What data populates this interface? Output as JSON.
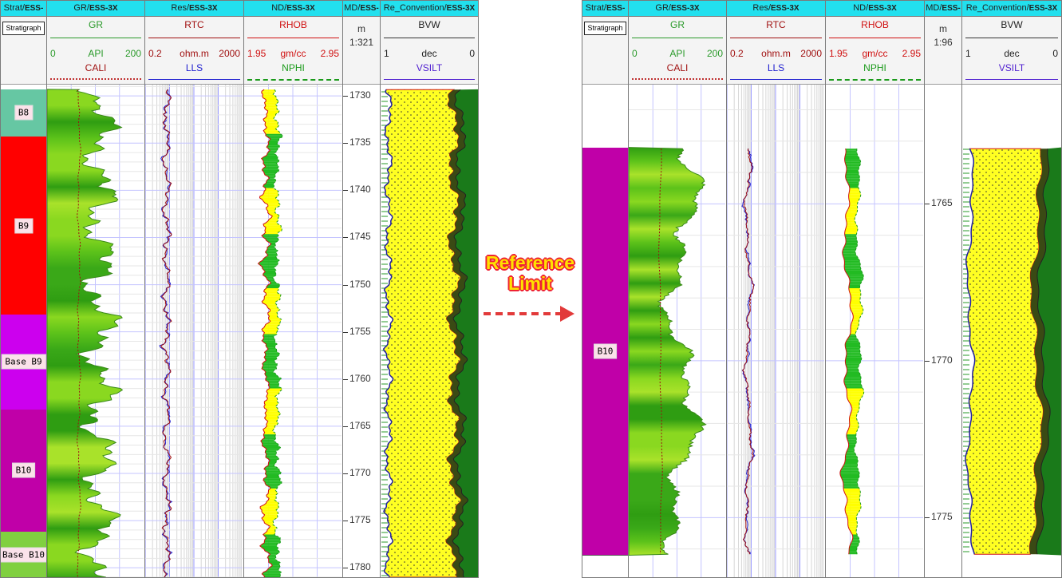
{
  "panels": [
    {
      "id": "left",
      "columns": {
        "strat": {
          "title": "Strat/",
          "suffix": "ESS-",
          "button": "Stratigraph"
        },
        "gr": {
          "title": "GR/",
          "suffix": "ESS-3X",
          "curve1": {
            "name": "GR",
            "lo": "0",
            "unit": "API",
            "hi": "200",
            "color": "#2a9a2a"
          },
          "curve2": {
            "name": "CALI",
            "color": "#a01010"
          }
        },
        "res": {
          "title": "Res/",
          "suffix": "ESS-3X",
          "curve1": {
            "name": "RTC",
            "lo": "0.2",
            "unit": "ohm.m",
            "hi": "2000",
            "color": "#a01010"
          },
          "curve2": {
            "name": "LLS",
            "color": "#2020d0"
          }
        },
        "nd": {
          "title": "ND/",
          "suffix": "ESS-3X",
          "curve1": {
            "name": "RHOB",
            "lo": "1.95",
            "unit": "gm/cc",
            "hi": "2.95",
            "color": "#d01010"
          },
          "curve2": {
            "name": "NPHI",
            "color": "#1a9a1a"
          }
        },
        "md": {
          "title": "MD/",
          "suffix": "ESS-",
          "unit": "m",
          "scale": "1:321"
        },
        "re": {
          "title": "Re_Convention/",
          "suffix": "ESS-3X",
          "curve1": {
            "name": "BVW",
            "lo": "1",
            "unit": "dec",
            "hi": "0",
            "color": "#222222"
          },
          "curve2": {
            "name": "VSILT",
            "color": "#5020d0"
          }
        }
      },
      "zones": [
        {
          "name": "B8",
          "top": 1729.3,
          "base": 1734.3,
          "color": "#66c7a3"
        },
        {
          "name": "B9",
          "top": 1734.3,
          "base": 1753.2,
          "color": "#ff0000"
        },
        {
          "name": "Base B9",
          "top": 1753.2,
          "base": 1763.2,
          "color": "#cc00ee"
        },
        {
          "name": "B10",
          "top": 1763.2,
          "base": 1776.2,
          "color": "#c000a8"
        },
        {
          "name": "Base B10",
          "top": 1776.2,
          "base": 1781.0,
          "color": "#80d040"
        }
      ],
      "depth_range": [
        1728.8,
        1781.0
      ],
      "depth_ticks": [
        "1730",
        "1735",
        "1740",
        "1745",
        "1750",
        "1755",
        "1760",
        "1765",
        "1770",
        "1775",
        "1780"
      ]
    },
    {
      "id": "right",
      "columns": {
        "strat": {
          "title": "Strat/",
          "suffix": "ESS-",
          "button": "Stratigraph"
        },
        "gr": {
          "title": "GR/",
          "suffix": "ESS-3X",
          "curve1": {
            "name": "GR",
            "lo": "0",
            "unit": "API",
            "hi": "200",
            "color": "#2a9a2a"
          },
          "curve2": {
            "name": "CALI",
            "color": "#a01010"
          }
        },
        "res": {
          "title": "Res/",
          "suffix": "ESS-3X",
          "curve1": {
            "name": "RTC",
            "lo": "0.2",
            "unit": "ohm.m",
            "hi": "2000",
            "color": "#a01010"
          },
          "curve2": {
            "name": "LLS",
            "color": "#2020d0"
          }
        },
        "nd": {
          "title": "ND/",
          "suffix": "ESS-3X",
          "curve1": {
            "name": "RHOB",
            "lo": "1.95",
            "unit": "gm/cc",
            "hi": "2.95",
            "color": "#d01010"
          },
          "curve2": {
            "name": "NPHI",
            "color": "#1a9a1a"
          }
        },
        "md": {
          "title": "MD/",
          "suffix": "ESS-",
          "unit": "m",
          "scale": "1:96"
        },
        "re": {
          "title": "Re_Convention/",
          "suffix": "ESS-3X",
          "curve1": {
            "name": "BVW",
            "lo": "1",
            "unit": "dec",
            "hi": "0",
            "color": "#222222"
          },
          "curve2": {
            "name": "VSILT",
            "color": "#5020d0"
          }
        }
      },
      "zones": [
        {
          "name": "B10",
          "top": 1763.2,
          "base": 1776.2,
          "color": "#c000a8"
        }
      ],
      "depth_range": [
        1761.2,
        1776.9
      ],
      "depth_ticks": [
        "1765",
        "1770",
        "1775"
      ]
    }
  ],
  "annotation": {
    "text_line1": "Reference",
    "text_line2": "Limit",
    "arrow_color": "#e23a3a",
    "text_color": "#ffe100"
  }
}
